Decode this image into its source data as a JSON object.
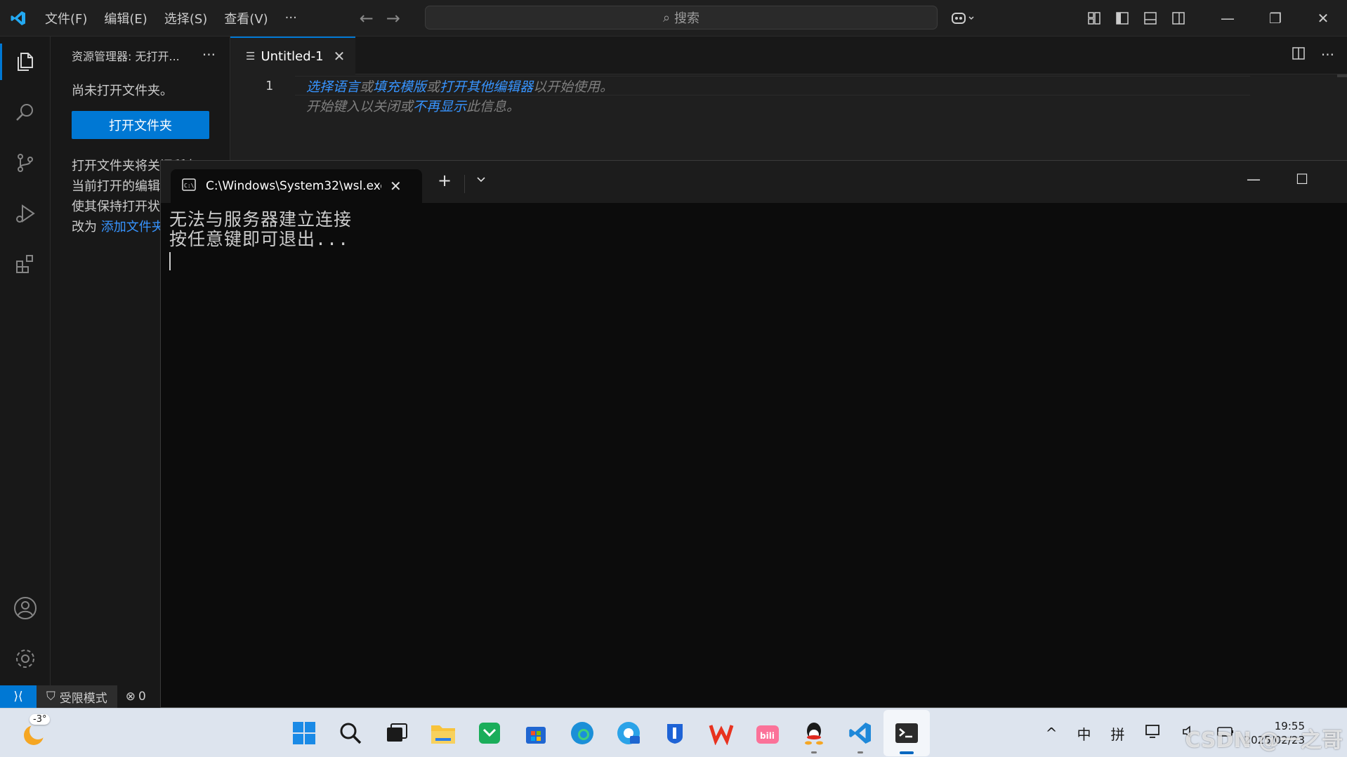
{
  "titlebar": {
    "menus": [
      "文件(F)",
      "编辑(E)",
      "选择(S)",
      "查看(V)",
      "···"
    ],
    "search_label": "搜索",
    "window_controls": [
      "—",
      "❐",
      "✕"
    ]
  },
  "sidebar": {
    "title": "资源管理器: 无打开...",
    "more": "···",
    "no_folder": "尚未打开文件夹。",
    "open_folder_button": "打开文件夹",
    "para_line1": "打开文件夹将关闭所有",
    "para_line2": "当前打开的编辑器。要",
    "para_line3": "使其保持打开状态，请",
    "para_line4_prefix": "改为 ",
    "para_line4_link": "添加文件夹"
  },
  "editor": {
    "tab_label": "Untitled-1",
    "tab_close": "✕",
    "line_number": "1",
    "hint1": {
      "a": "选择语言",
      "b": "或",
      "c": "填充模版",
      "d": "或",
      "e": "打开其他编辑器",
      "f": "以开始使用。"
    },
    "hint2": {
      "a": "开始键入以关闭或",
      "b": "不再显示",
      "c": "此信息。"
    }
  },
  "statusbar": {
    "restricted": "受限模式",
    "errors": "0"
  },
  "terminal": {
    "tab_title": "C:\\Windows\\System32\\wsl.exe",
    "tab_close": "✕",
    "new_tab": "+",
    "line1": "无法与服务器建立连接",
    "line2": "按任意键即可退出...",
    "controls": [
      "—",
      "☐"
    ]
  },
  "taskbar": {
    "weather_temp": "-3°",
    "apps": [
      "start-icon",
      "search-icon",
      "task-view-icon",
      "file-explorer-icon",
      "wechat-icon",
      "store-icon",
      "edge-icon",
      "edge-ai-icon",
      "lenovo-icon",
      "wps-icon",
      "bilibili-icon",
      "qq-icon",
      "vscode-icon",
      "terminal-icon"
    ],
    "tray_chevron": "^",
    "ime_lang": "中",
    "ime_mode": "拼",
    "time": "19:55",
    "date": "2025/02/23",
    "watermark": "CSDN @一之哥"
  },
  "colors": {
    "accent": "#0078d4",
    "link": "#3794ff",
    "editor_bg": "#1f1f1f",
    "terminal_bg": "#0c0c0c",
    "taskbar_bg": "#dde4ee"
  }
}
